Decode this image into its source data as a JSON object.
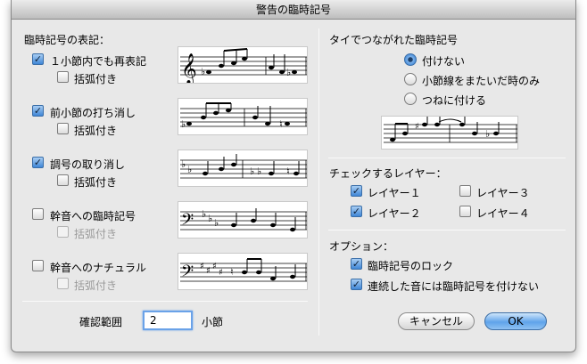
{
  "window": {
    "title": "警告の臨時記号"
  },
  "display_section": {
    "heading": "臨時記号の表記：",
    "options": [
      {
        "label": "１小節内でも再表記",
        "checked": true,
        "paren_label": "括弧付き",
        "paren_checked": false,
        "paren_enabled": true
      },
      {
        "label": "前小節の打ち消し",
        "checked": true,
        "paren_label": "括弧付き",
        "paren_checked": false,
        "paren_enabled": true
      },
      {
        "label": "調号の取り消し",
        "checked": true,
        "paren_label": "括弧付き",
        "paren_checked": false,
        "paren_enabled": true
      },
      {
        "label": "幹音への臨時記号",
        "checked": false,
        "paren_label": "括弧付き",
        "paren_checked": false,
        "paren_enabled": false
      },
      {
        "label": "幹音へのナチュラル",
        "checked": false,
        "paren_label": "括弧付き",
        "paren_checked": false,
        "paren_enabled": false
      }
    ]
  },
  "tie_section": {
    "heading": "タイでつながれた臨時記号",
    "options": [
      {
        "label": "付けない",
        "selected": true
      },
      {
        "label": "小節線をまたいだ時のみ",
        "selected": false
      },
      {
        "label": "つねに付ける",
        "selected": false
      }
    ]
  },
  "layer_section": {
    "heading": "チェックするレイヤー：",
    "layers": [
      {
        "label": "レイヤー１",
        "checked": true
      },
      {
        "label": "レイヤー３",
        "checked": false
      },
      {
        "label": "レイヤー２",
        "checked": true
      },
      {
        "label": "レイヤー４",
        "checked": false
      }
    ]
  },
  "options_section": {
    "heading": "オプション：",
    "options": [
      {
        "label": "臨時記号のロック",
        "checked": true
      },
      {
        "label": "連続した音には臨時記号を付けない",
        "checked": true
      }
    ]
  },
  "range": {
    "label": "確認範囲",
    "value": "2",
    "unit": "小節"
  },
  "buttons": {
    "cancel": "キャンセル",
    "ok": "OK"
  },
  "colors": {
    "accent": "#3f86d6",
    "focus_ring": "#6aa2e8"
  },
  "icons": [
    "treble-clef-icon",
    "bass-clef-icon",
    "flat-icon",
    "sharp-icon",
    "natural-icon"
  ]
}
